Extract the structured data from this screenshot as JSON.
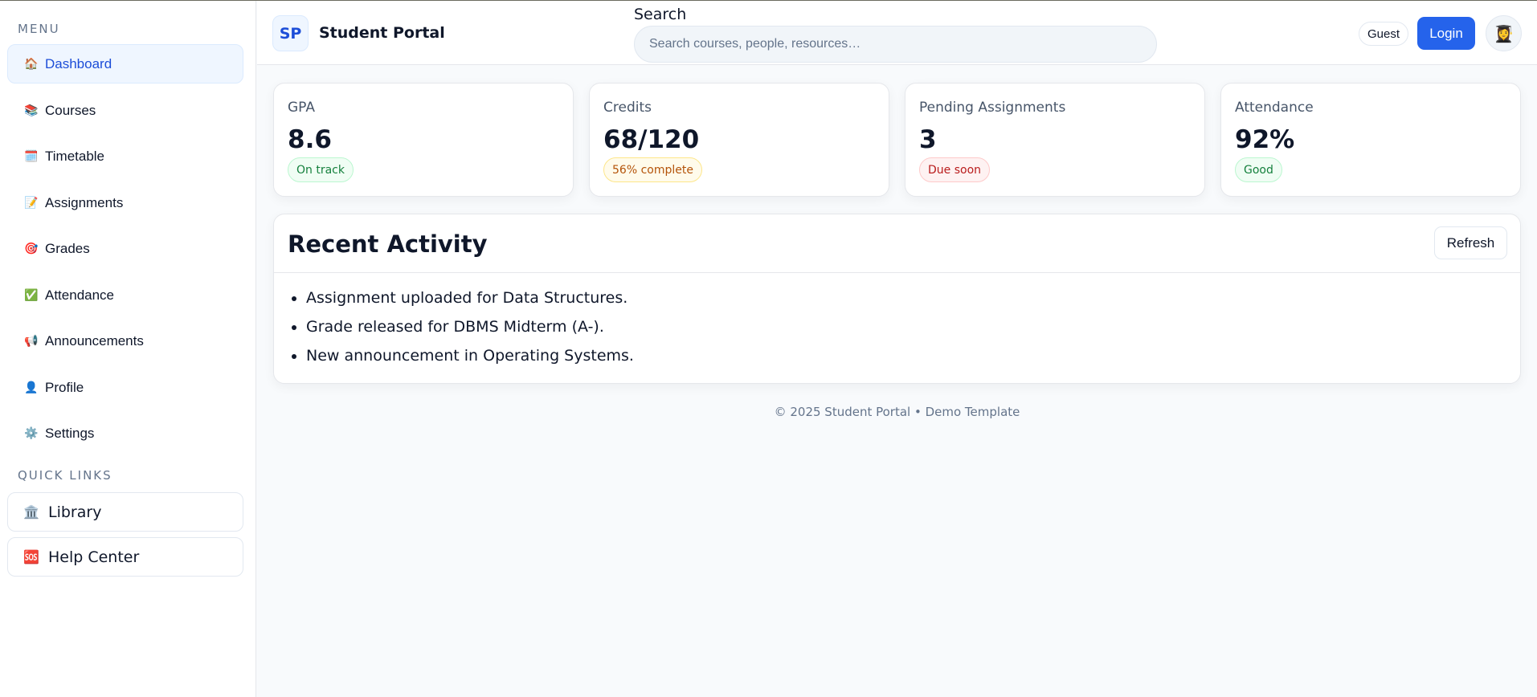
{
  "sidebar": {
    "menu_title": "MENU",
    "items": [
      {
        "label": "Dashboard",
        "icon": "🏠"
      },
      {
        "label": "Courses",
        "icon": "📚"
      },
      {
        "label": "Timetable",
        "icon": "🗓️"
      },
      {
        "label": "Assignments",
        "icon": "📝"
      },
      {
        "label": "Grades",
        "icon": "🎯"
      },
      {
        "label": "Attendance",
        "icon": "✅"
      },
      {
        "label": "Announcements",
        "icon": "📢"
      },
      {
        "label": "Profile",
        "icon": "👤"
      },
      {
        "label": "Settings",
        "icon": "⚙️"
      }
    ],
    "quick_links_title": "QUICK LINKS",
    "quick_links": [
      {
        "label": "Library",
        "icon": "🏛️"
      },
      {
        "label": "Help Center",
        "icon": "🆘"
      }
    ]
  },
  "header": {
    "logo": "SP",
    "title": "Student Portal",
    "search_label": "Search",
    "search_placeholder": "Search courses, people, resources…",
    "guest": "Guest",
    "login": "Login",
    "avatar": "👩‍🎓"
  },
  "stats": [
    {
      "label": "GPA",
      "value": "8.6",
      "badge": "On track"
    },
    {
      "label": "Credits",
      "value": "68/120",
      "badge": "56% complete"
    },
    {
      "label": "Pending Assignments",
      "value": "3",
      "badge": "Due soon"
    },
    {
      "label": "Attendance",
      "value": "92%",
      "badge": "Good"
    }
  ],
  "activity": {
    "title": "Recent Activity",
    "refresh": "Refresh",
    "items": [
      "Assignment uploaded for Data Structures.",
      "Grade released for DBMS Midterm (A-).",
      "New announcement in Operating Systems."
    ]
  },
  "footer": "© 2025 Student Portal • Demo Template",
  "colors": {
    "accent": "#2563eb",
    "active_bg": "#eff6ff",
    "page_bg": "#f8fafc"
  }
}
